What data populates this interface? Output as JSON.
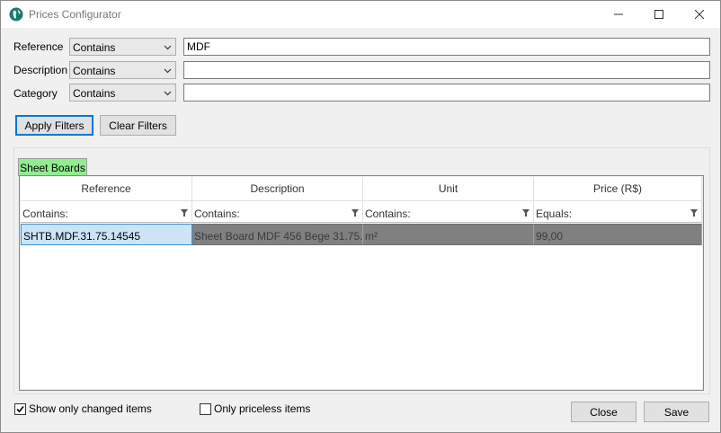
{
  "window": {
    "title": "Prices Configurator",
    "accent_color": "#0078d7"
  },
  "filters": {
    "reference": {
      "label": "Reference",
      "mode": "Contains",
      "value": "MDF"
    },
    "description": {
      "label": "Description",
      "mode": "Contains",
      "value": ""
    },
    "category": {
      "label": "Category",
      "mode": "Contains",
      "value": ""
    }
  },
  "actions": {
    "apply_label": "Apply Filters",
    "clear_label": "Clear Filters"
  },
  "tab": {
    "label": "Sheet Boards",
    "color": "#90ee90"
  },
  "grid": {
    "columns": [
      {
        "header": "Reference",
        "filter": "Contains:"
      },
      {
        "header": "Description",
        "filter": "Contains:"
      },
      {
        "header": "Unit",
        "filter": "Contains:"
      },
      {
        "header": "Price (R$)",
        "filter": "Equals:"
      }
    ],
    "rows": [
      {
        "reference": "SHTB.MDF.31.75.14545",
        "description": "Sheet Board MDF 456 Bege 31.75...",
        "unit": "m²",
        "price": "99,00"
      }
    ]
  },
  "options": {
    "show_changed_label": "Show only changed items",
    "show_changed_checked": true,
    "priceless_label": "Only priceless items",
    "priceless_checked": false
  },
  "footer": {
    "close_label": "Close",
    "save_label": "Save"
  }
}
